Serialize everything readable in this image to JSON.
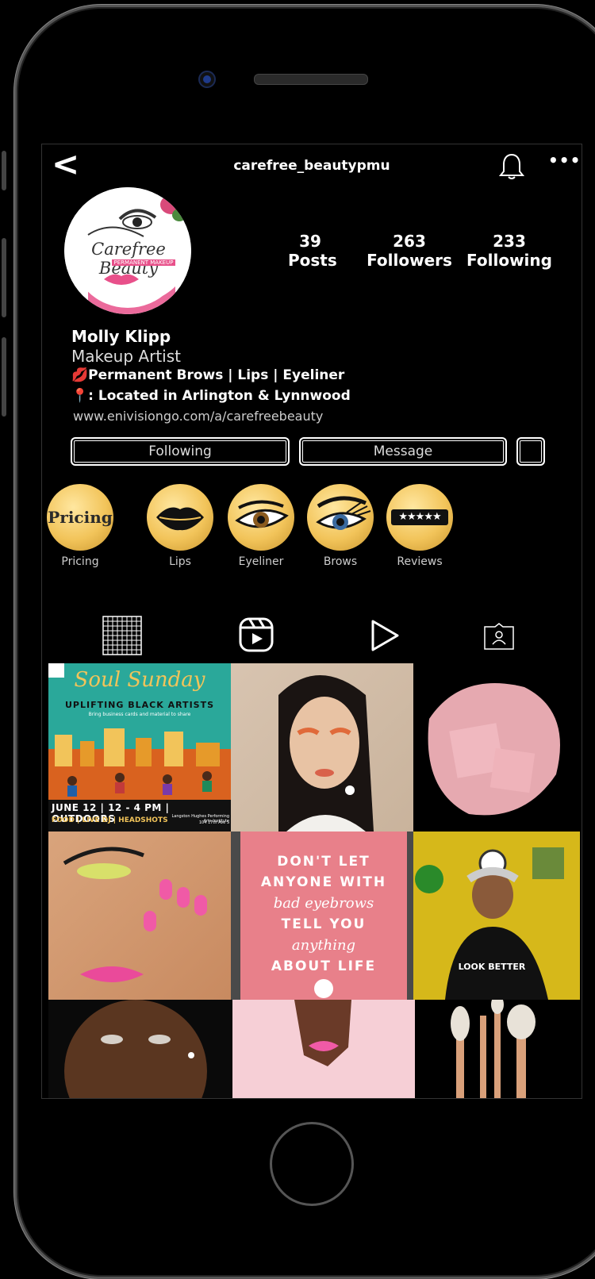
{
  "profile": {
    "username": "carefree_beautypmu",
    "avatar_title": "Carefree Beauty",
    "avatar_subtitle": "PERMANENT MAKEUP",
    "name": "Molly Klipp",
    "role": "Makeup Artist",
    "bio_line1": "💋Permanent Brows | Lips | Eyeliner",
    "bio_line2": "📍: Located in Arlington & Lynnwood",
    "link": "www.enivisiongo.com/a/carefreebeauty"
  },
  "stats": {
    "posts_count": "39",
    "posts_label": "Posts",
    "followers_count": "263",
    "followers_label": "Followers",
    "following_count": "233",
    "following_label": "Following"
  },
  "buttons": {
    "following": "Following",
    "message": "Message"
  },
  "highlights": [
    {
      "label": "Pricing",
      "cover_text": "Pricing"
    },
    {
      "label": "Lips"
    },
    {
      "label": "Eyeliner"
    },
    {
      "label": "Brows"
    },
    {
      "label": "Reviews",
      "cover_text": "★★★★★"
    }
  ],
  "posts": {
    "soul_sunday": {
      "title": "Soul Sunday",
      "subtitle": "UPLIFTING BLACK ARTISTS",
      "note": "Bring business cards and material to share",
      "line1": "JUNE 12 | 12 - 4 PM | OUTDOORS",
      "line2": "FOOD | LIVE DJ | HEADSHOTS",
      "venue": "Langston Hughes Performing Arts Institute",
      "address": "104 17th Ave S"
    },
    "quote": {
      "l1": "DON'T LET",
      "l2": "ANYONE WITH",
      "l3": "bad eyebrows",
      "l4": "TELL YOU",
      "l5": "anything",
      "l6": "ABOUT LIFE"
    },
    "shirt_text": "LOOK BETTER"
  },
  "colors": {
    "gold": "#f2c45a",
    "pink": "#e8808a",
    "teal": "#22a89a",
    "orange": "#d9621f"
  }
}
